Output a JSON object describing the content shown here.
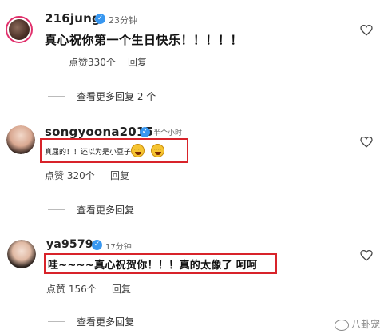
{
  "comments": [
    {
      "username": "216jung",
      "time": "23分钟",
      "text": "真心祝你第一个生日快乐！！！！！",
      "likes": "点赞330个",
      "reply": "回复",
      "view_more": "查看更多回复 2 个"
    },
    {
      "username": "songyoona2015",
      "time": "半个小时",
      "text": "真屈的！！还以为是小豆子呢",
      "likes": "点赞 320个",
      "reply": "回复",
      "view_more": "查看更多回复"
    },
    {
      "username": "ya9579",
      "time": "17分钟",
      "text": "哇~~~~真心祝贺你！！！真的太像了 呵呵",
      "likes": "点赞 156个",
      "reply": "回复",
      "view_more": "查看更多回复"
    }
  ],
  "watermark": "八卦宠",
  "icons": {
    "like": "heart-icon",
    "verified": "verified-badge-icon",
    "emoji": "grinning-squint-emoji-icon",
    "watermark": "weibo-icon"
  },
  "colors": {
    "highlight_box": "#d8232a",
    "verified": "#3897f0",
    "story_ring": "#e1306c"
  }
}
